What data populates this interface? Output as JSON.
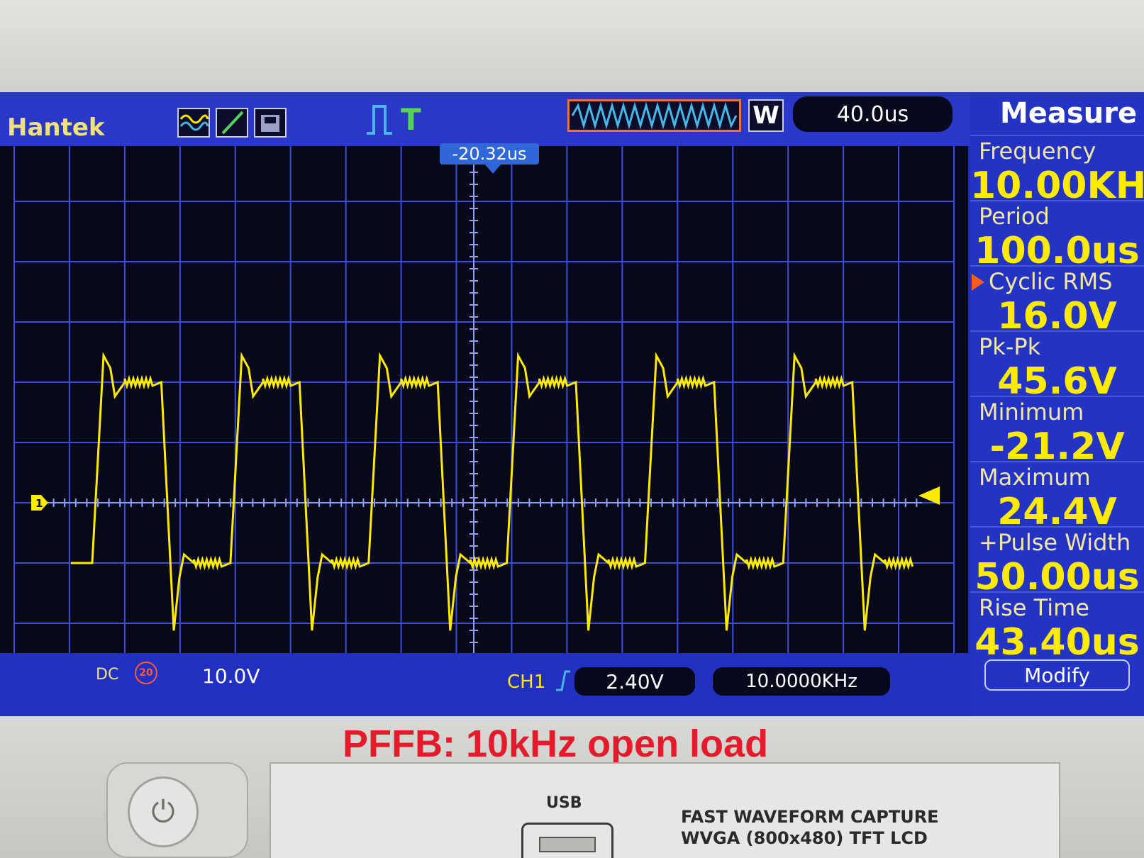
{
  "header": {
    "brand": "Hantek",
    "trigger_position": "-20.32us",
    "window_mode": "W",
    "timebase": "40.0us"
  },
  "measure_panel": {
    "title": "Measure",
    "items": [
      {
        "label": "Frequency",
        "value": "10.00KHz"
      },
      {
        "label": "Period",
        "value": "100.0us"
      },
      {
        "label": "Cyclic RMS",
        "value": "16.0V",
        "selected": true
      },
      {
        "label": "Pk-Pk",
        "value": "45.6V"
      },
      {
        "label": "Minimum",
        "value": "-21.2V"
      },
      {
        "label": "Maximum",
        "value": "24.4V"
      },
      {
        "label": "+Pulse Width",
        "value": "50.00us"
      },
      {
        "label": "Rise Time",
        "value": "43.40us"
      }
    ],
    "modify_label": "Modify"
  },
  "status": {
    "coupling": "DC",
    "bw_limit": "20",
    "ch1_scale": "10.0V",
    "trigger_channel": "CH1",
    "trigger_level": "2.40V",
    "frequency_counter": "10.0000KHz"
  },
  "channel_marker": "1",
  "caption": "PFFB: 10kHz open load",
  "panel": {
    "usb_label": "USB",
    "feature_line1": "FAST WAVEFORM CAPTURE",
    "feature_line2": "WVGA (800x480) TFT LCD"
  },
  "colors": {
    "trace": "#ffeb00",
    "grid": "#3b4de0",
    "screen_bg": "#07091a",
    "panel_bg": "#2333c4",
    "caption": "#e31b2a"
  },
  "icons": [
    "ch-waveform-icon",
    "cursor-icon",
    "save-icon",
    "run-icon",
    "trigger-icon",
    "power-icon"
  ],
  "chart_data": {
    "type": "line",
    "title": "",
    "xlabel": "",
    "ylabel": "",
    "timebase_per_div": "40.0us",
    "volts_per_div": "10.0V",
    "series": [
      {
        "name": "CH1",
        "signal": "square wave",
        "frequency": "10.00KHz",
        "period": "100.0us",
        "max": 24.4,
        "min": -21.2,
        "pk_pk": 45.6,
        "cyclic_rms": 16.0,
        "pulse_width": "50.00us",
        "rise_time": "43.40us"
      }
    ]
  }
}
